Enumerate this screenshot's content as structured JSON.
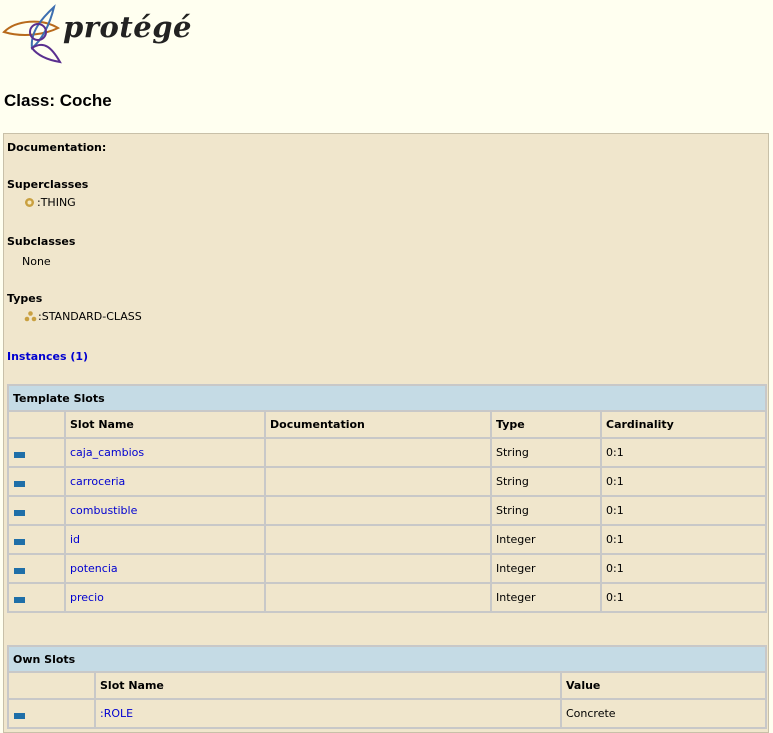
{
  "logo": {
    "text": "protégé"
  },
  "page_title": "Class: Coche",
  "sections": {
    "documentation_label": "Documentation:",
    "superclasses_label": "Superclasses",
    "superclass_item": ":THING",
    "subclasses_label": "Subclasses",
    "subclasses_value": "None",
    "types_label": "Types",
    "type_item": ":STANDARD-CLASS",
    "instances_link": "Instances (1)"
  },
  "template_slots": {
    "caption": "Template Slots",
    "headers": [
      "Slot Name",
      "Documentation",
      "Type",
      "Cardinality"
    ],
    "rows": [
      {
        "name": "caja_cambios",
        "documentation": "",
        "type": "String",
        "cardinality": "0:1"
      },
      {
        "name": "carroceria",
        "documentation": "",
        "type": "String",
        "cardinality": "0:1"
      },
      {
        "name": "combustible",
        "documentation": "",
        "type": "String",
        "cardinality": "0:1"
      },
      {
        "name": "id",
        "documentation": "",
        "type": "Integer",
        "cardinality": "0:1"
      },
      {
        "name": "potencia",
        "documentation": "",
        "type": "Integer",
        "cardinality": "0:1"
      },
      {
        "name": "precio",
        "documentation": "",
        "type": "Integer",
        "cardinality": "0:1"
      }
    ]
  },
  "own_slots": {
    "caption": "Own Slots",
    "headers": [
      "Slot Name",
      "Value"
    ],
    "rows": [
      {
        "name": ":ROLE",
        "value": "Concrete"
      }
    ]
  },
  "colors": {
    "page_background": "#fffff0",
    "panel_background": "#f0e6cc",
    "table_caption_background": "#c5dbe5",
    "link": "#0000d0",
    "slot_icon": "#1f6fa8",
    "superclass_icon": "#c9a040"
  }
}
